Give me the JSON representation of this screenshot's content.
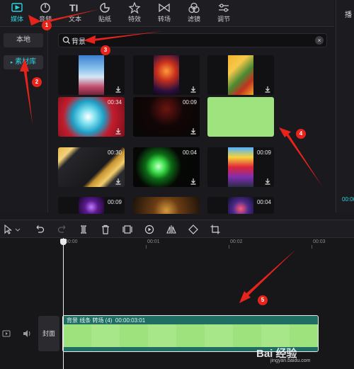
{
  "toolbar": {
    "tabs": [
      {
        "label": "媒体",
        "icon": "media-icon",
        "active": true
      },
      {
        "label": "音频",
        "icon": "audio-icon"
      },
      {
        "label": "文本",
        "icon": "text-icon"
      },
      {
        "label": "贴纸",
        "icon": "sticker-icon"
      },
      {
        "label": "特效",
        "icon": "effects-icon"
      },
      {
        "label": "转场",
        "icon": "transition-icon"
      },
      {
        "label": "滤镜",
        "icon": "filter-icon"
      },
      {
        "label": "调节",
        "icon": "adjust-icon"
      }
    ],
    "accent": "#2bd3e0"
  },
  "right_panel": {
    "heading": "播",
    "timecode": "00:00"
  },
  "sidebar": {
    "local_label": "本地",
    "library_label": "素材库"
  },
  "search": {
    "value": "背景",
    "clear_label": "×"
  },
  "materials": [
    {
      "duration": ""
    },
    {
      "duration": ""
    },
    {
      "duration": ""
    },
    {
      "duration": "00:34"
    },
    {
      "duration": "00:09"
    },
    {
      "duration": ""
    },
    {
      "duration": "00:30"
    },
    {
      "duration": "00:04"
    },
    {
      "duration": "00:09"
    },
    {
      "duration": "00:09"
    },
    {
      "duration": ""
    },
    {
      "duration": "00:04"
    }
  ],
  "annotations": [
    "1",
    "2",
    "3",
    "4",
    "5"
  ],
  "timeline": {
    "ticks": [
      "00:00",
      "00:01",
      "00:02",
      "00:03"
    ],
    "cover_label": "封面",
    "clip_title": "背景 线条 转场 (4)",
    "clip_duration": "00:00:03:01"
  },
  "watermark": {
    "text": "Bai 经验",
    "sub": "jingyan.baidu.com"
  }
}
